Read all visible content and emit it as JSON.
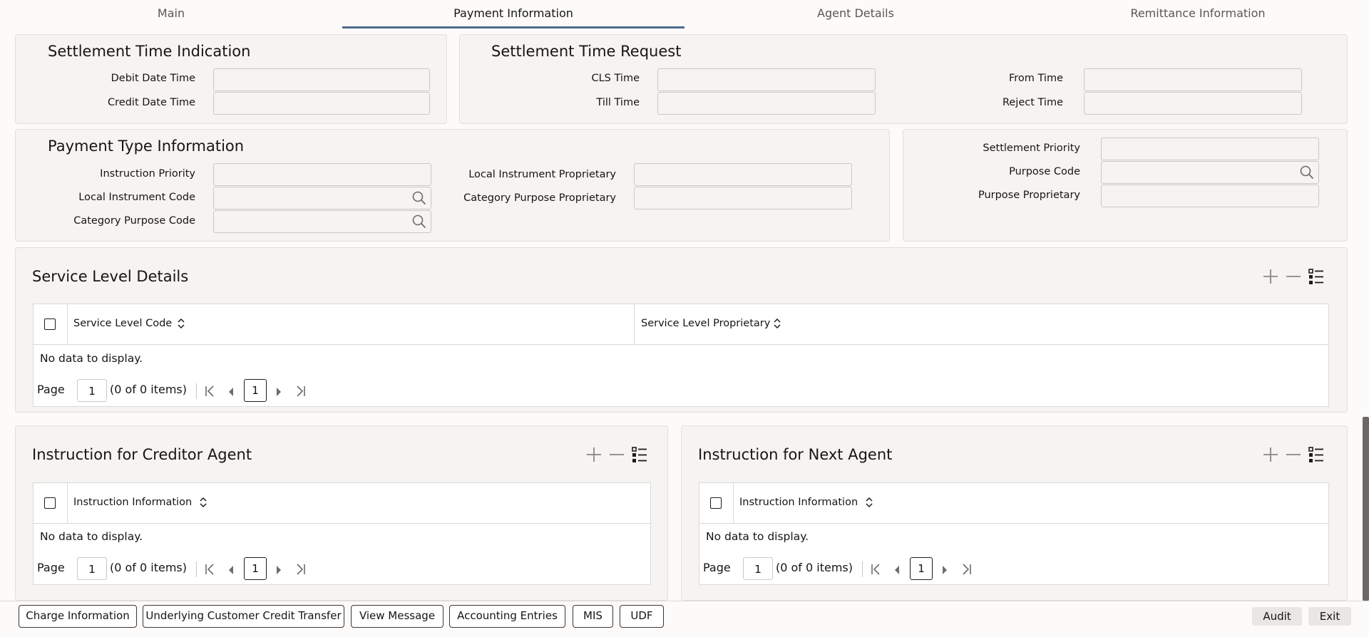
{
  "tabs": [
    {
      "label": "Main"
    },
    {
      "label": "Payment Information"
    },
    {
      "label": "Agent Details"
    },
    {
      "label": "Remittance Information"
    }
  ],
  "active_tab": "Payment Information",
  "settlement_time_indication": {
    "title": "Settlement Time Indication",
    "debit_date_time_label": "Debit Date Time",
    "debit_date_time_value": "",
    "credit_date_time_label": "Credit Date Time",
    "credit_date_time_value": ""
  },
  "settlement_time_request": {
    "title": "Settlement Time Request",
    "cls_time_label": "CLS Time",
    "cls_time_value": "",
    "till_time_label": "Till Time",
    "till_time_value": "",
    "from_time_label": "From Time",
    "from_time_value": "",
    "reject_time_label": "Reject Time",
    "reject_time_value": ""
  },
  "payment_type_information": {
    "title": "Payment Type Information",
    "instruction_priority_label": "Instruction Priority",
    "instruction_priority_value": "",
    "local_instrument_code_label": "Local Instrument Code",
    "local_instrument_code_value": "",
    "category_purpose_code_label": "Category Purpose Code",
    "category_purpose_code_value": "",
    "local_instrument_proprietary_label": "Local Instrument Proprietary",
    "local_instrument_proprietary_value": "",
    "category_purpose_proprietary_label": "Category Purpose Proprietary",
    "category_purpose_proprietary_value": ""
  },
  "settlement_purpose": {
    "settlement_priority_label": "Settlement Priority",
    "settlement_priority_value": "",
    "purpose_code_label": "Purpose Code",
    "purpose_code_value": "",
    "purpose_proprietary_label": "Purpose Proprietary",
    "purpose_proprietary_value": ""
  },
  "service_level_details": {
    "title": "Service Level Details",
    "columns": [
      "Service Level Code",
      "Service Level Proprietary"
    ],
    "empty_text": "No data to display.",
    "page_label": "Page",
    "page_value": "1",
    "items_text": "(0 of 0 items)",
    "current_page": "1"
  },
  "instruction_creditor_agent": {
    "title": "Instruction for Creditor Agent",
    "columns": [
      "Instruction Information"
    ],
    "empty_text": "No data to display.",
    "page_label": "Page",
    "page_value": "1",
    "items_text": "(0 of 0 items)",
    "current_page": "1"
  },
  "instruction_next_agent": {
    "title": "Instruction for Next Agent",
    "columns": [
      "Instruction Information"
    ],
    "empty_text": "No data to display.",
    "page_label": "Page",
    "page_value": "1",
    "items_text": "(0 of 0 items)",
    "current_page": "1"
  },
  "footer_buttons": {
    "charge_information": "Charge Information",
    "underlying_transfer": "Underlying Customer Credit Transfer",
    "view_message": "View Message",
    "accounting_entries": "Accounting Entries",
    "mis": "MIS",
    "udf": "UDF",
    "audit": "Audit",
    "exit": "Exit"
  },
  "icons": {
    "search": "search-icon",
    "add": "plus-icon",
    "remove": "minus-icon",
    "columns": "list-columns-icon",
    "sort": "sort-icon",
    "first": "first-page-icon",
    "prev": "prev-page-icon",
    "next": "next-page-icon",
    "last": "last-page-icon"
  },
  "colors": {
    "tab_indicator": "#3d5a80",
    "panel_bg": "#f5f4f2",
    "page_bg": "#fcfbfa"
  }
}
